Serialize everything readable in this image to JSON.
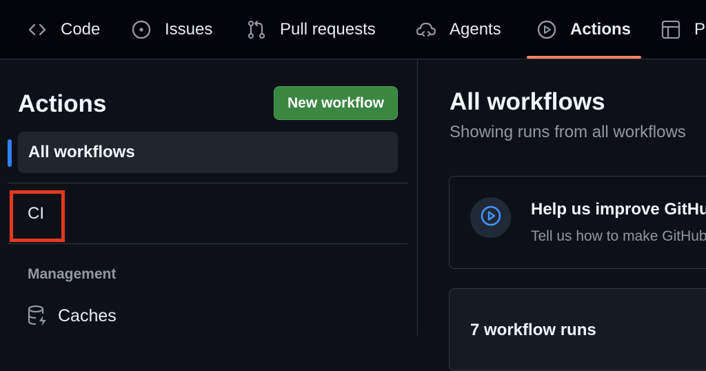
{
  "topnav": {
    "tabs": [
      {
        "label": "Code",
        "icon": "code-icon"
      },
      {
        "label": "Issues",
        "icon": "issue-circle-icon"
      },
      {
        "label": "Pull requests",
        "icon": "pull-request-icon"
      },
      {
        "label": "Agents",
        "icon": "agent-cloud-icon"
      },
      {
        "label": "Actions",
        "icon": "play-circle-icon",
        "selected": true
      },
      {
        "label": "Pr",
        "icon": "project-table-icon"
      }
    ],
    "accent_color": "#f78166"
  },
  "sidebar": {
    "title": "Actions",
    "new_workflow_label": "New workflow",
    "all_workflows_label": "All workflows",
    "workflows": [
      {
        "label": "CI",
        "highlighted": true
      }
    ],
    "management_heading": "Management",
    "management_items": [
      {
        "label": "Caches",
        "icon": "database-icon"
      }
    ],
    "highlight_color": "#e2391f",
    "active_marker_color": "#2f81f7"
  },
  "main": {
    "title": "All workflows",
    "subtitle": "Showing runs from all workflows",
    "banner": {
      "title": "Help us improve GitHub Actions",
      "text": "Tell us how to make GitHub Actions work better for you",
      "icon": "play-circle-icon"
    },
    "runs_count_label": "7 workflow runs"
  },
  "colors": {
    "background": "#0d1117",
    "topbar": "#010409",
    "button_green": "#3b8640",
    "border": "#30363d"
  }
}
